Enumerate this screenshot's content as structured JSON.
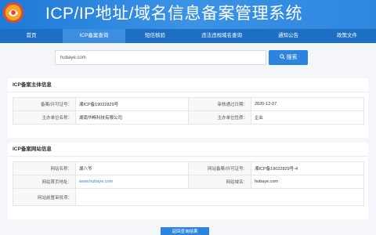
{
  "header": {
    "title": "ICP/IP地址/域名信息备案管理系统",
    "logo_icon": "ministry-emblem-icon",
    "brand_color": "#1f7ad6"
  },
  "nav": {
    "items": [
      {
        "label": "首页"
      },
      {
        "label": "ICP备案查询"
      },
      {
        "label": "短信核验"
      },
      {
        "label": "违法违规域名查询"
      },
      {
        "label": "通知公告"
      },
      {
        "label": "政策文件"
      }
    ],
    "active_index": 1
  },
  "search": {
    "value": "hubaye.com",
    "button_label": "搜索",
    "button_icon": "search-icon"
  },
  "subject_panel": {
    "title": "ICP备案主体信息",
    "rows": [
      {
        "label1": "备案/许可证号：",
        "value1": "湘ICP备19022829号",
        "label2": "审核通过日期：",
        "value2": "2020-12-07"
      },
      {
        "label1": "主办单位名称：",
        "value1": "湖南华畅科技有限公司",
        "label2": "主办单位性质：",
        "value2": "企业"
      }
    ]
  },
  "website_panel": {
    "title": "ICP备案网站信息",
    "rows": [
      {
        "label1": "网站名称：",
        "value1": "湖八爷",
        "label2": "网站备案/许可证号：",
        "value2": "湘ICP备19022829号-4"
      },
      {
        "label1": "网站首页地址：",
        "value1": "www.hubaye.com",
        "label2": "网站域名：",
        "value2": "hubaye.com"
      },
      {
        "label1": "网站前置审批项：",
        "value1": "",
        "label2": "",
        "value2": ""
      }
    ]
  },
  "return_button": {
    "label": "返回查询结果"
  },
  "colors": {
    "accent": "#2c84de",
    "nav_bg": "#1d6fc4",
    "nav_active": "#3c8fe0",
    "page_bg": "#f4f6f9"
  }
}
